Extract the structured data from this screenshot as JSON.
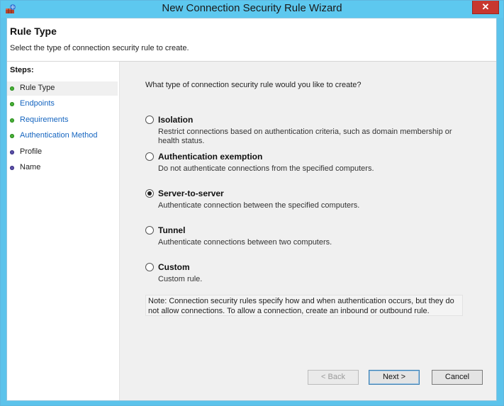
{
  "window": {
    "title": "New Connection Security Rule Wizard",
    "close_label": "✕"
  },
  "header": {
    "title": "Rule Type",
    "description": "Select the type of connection security rule to create."
  },
  "steps": {
    "heading": "Steps:",
    "items": [
      {
        "label": "Rule Type",
        "status": "complete",
        "active": true
      },
      {
        "label": "Endpoints",
        "status": "complete",
        "active": false
      },
      {
        "label": "Requirements",
        "status": "complete",
        "active": false
      },
      {
        "label": "Authentication Method",
        "status": "complete",
        "active": false
      },
      {
        "label": "Profile",
        "status": "pending",
        "active": false
      },
      {
        "label": "Name",
        "status": "pending",
        "active": false
      }
    ]
  },
  "main": {
    "question": "What type of connection security rule would you like to create?",
    "options": [
      {
        "title": "Isolation",
        "description": "Restrict connections based on authentication criteria, such as domain membership or health status.",
        "selected": false
      },
      {
        "title": "Authentication exemption",
        "description": "Do not authenticate connections from the specified computers.",
        "selected": false
      },
      {
        "title": "Server-to-server",
        "description": "Authenticate connection between the specified computers.",
        "selected": true
      },
      {
        "title": "Tunnel",
        "description": "Authenticate connections between two computers.",
        "selected": false
      },
      {
        "title": "Custom",
        "description": "Custom rule.",
        "selected": false
      }
    ],
    "note": "Note:  Connection security rules specify how and when authentication occurs, but they do not allow connections.  To allow a connection, create an inbound or outbound rule."
  },
  "buttons": {
    "back": "< Back",
    "next": "Next >",
    "cancel": "Cancel"
  },
  "colors": {
    "titlebar": "#5dc8ef",
    "close": "#c7372f",
    "step_complete": "#46b036",
    "step_pending": "#5a4ea8",
    "link": "#1565c0"
  }
}
